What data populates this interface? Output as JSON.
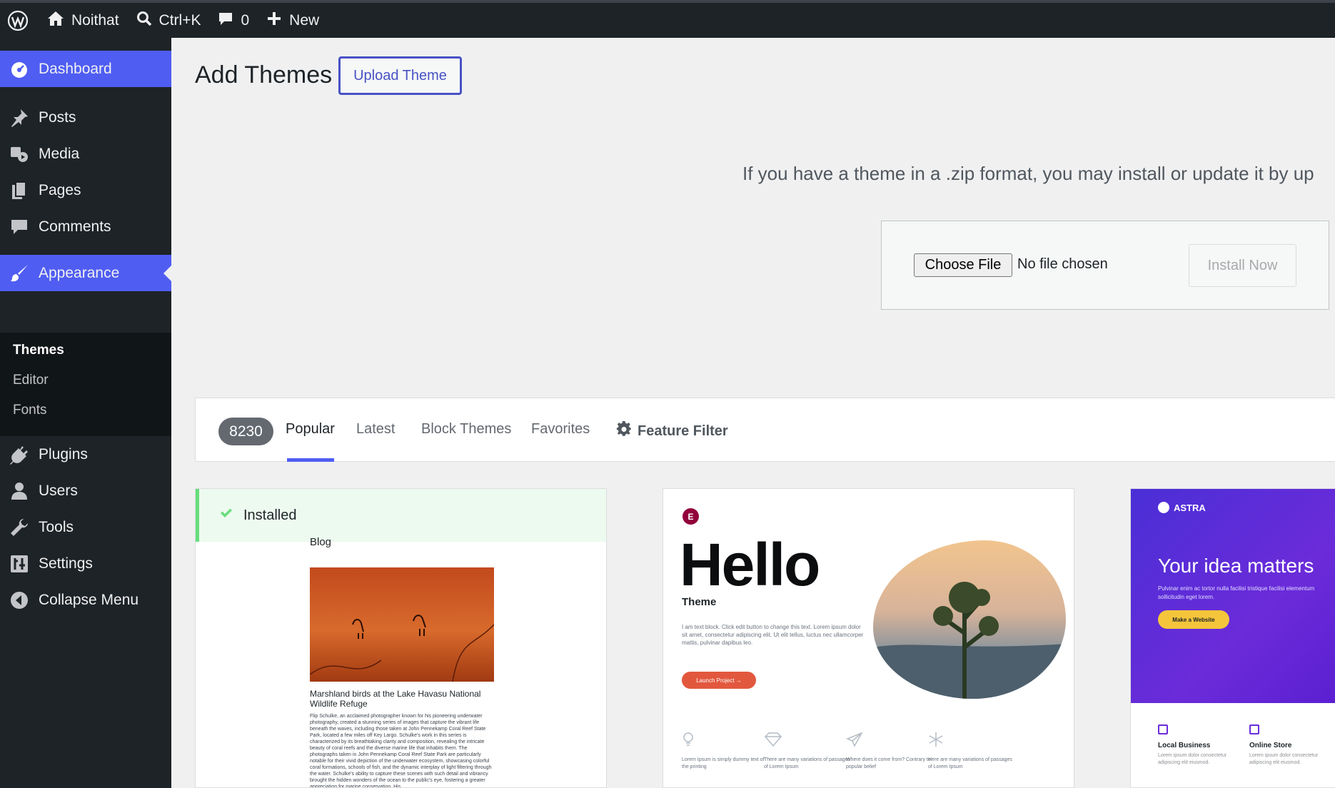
{
  "adminbar": {
    "site_name": "Noithat",
    "search_shortcut": "Ctrl+K",
    "comments_count": "0",
    "new_label": "New"
  },
  "sidebar": {
    "items": [
      {
        "label": "Dashboard",
        "icon": "dashboard-icon"
      },
      {
        "label": "Posts",
        "icon": "pin-icon"
      },
      {
        "label": "Media",
        "icon": "media-icon"
      },
      {
        "label": "Pages",
        "icon": "pages-icon"
      },
      {
        "label": "Comments",
        "icon": "comment-icon"
      },
      {
        "label": "Appearance",
        "icon": "brush-icon"
      },
      {
        "label": "Plugins",
        "icon": "plug-icon"
      },
      {
        "label": "Users",
        "icon": "user-icon"
      },
      {
        "label": "Tools",
        "icon": "wrench-icon"
      },
      {
        "label": "Settings",
        "icon": "settings-icon"
      },
      {
        "label": "Collapse Menu",
        "icon": "collapse-icon"
      }
    ],
    "submenu": [
      "Themes",
      "Editor",
      "Fonts"
    ]
  },
  "main": {
    "title": "Add Themes",
    "upload_button": "Upload Theme",
    "upload_help": "If you have a theme in a .zip format, you may install or update it by up",
    "choose_file": "Choose File",
    "no_file": "No file chosen",
    "install_now": "Install Now"
  },
  "filters": {
    "count": "8230",
    "tabs": [
      "Popular",
      "Latest",
      "Block Themes",
      "Favorites"
    ],
    "feature_filter": "Feature Filter"
  },
  "cards": {
    "installed_label": "Installed",
    "blog_word": "Blog",
    "bird_caption": "Marshland birds at the Lake Havasu National Wildlife Refuge",
    "bird_body": "Flip Schulke, an acclaimed photographer known for his pioneering underwater photography, created a stunning series of images that capture the vibrant life beneath the waves, including those taken at John Pennekamp Coral Reef State Park, located a few miles off Key Largo. Schulke's work in this series is characterized by its breathtaking clarity and composition, revealing the intricate beauty of coral reefs and the diverse marine life that inhabits them. The photographs taken in John Pennekamp Coral Reef State Park are particularly notable for their vivid depiction of the underwater ecosystem, showcasing colorful coral formations, schools of fish, and the dynamic interplay of light filtering through the water. Schulke's ability to capture these scenes with such detail and vibrancy brought the hidden wonders of the ocean to the public's eye, fostering a greater appreciation for marine conservation. His",
    "hello_logo": "E",
    "hello_title": "Hello",
    "hello_sub": "Theme",
    "hello_text": "I am text block. Click edit button to change this text. Lorem ipsum dolor sit amet, consectetur adipiscing elit. Ut elit tellus, luctus nec ullamcorper mattis, pulvinar dapibus leo.",
    "hello_cta": "Launch Project  →",
    "hello_features": [
      "Lorem Ipsum is simply dummy text of the printing",
      "There are many variations of passages of Lorem Ipsum",
      "Where does it come from? Contrary to popular belief",
      "Here are many variations of passages of Lorem Ipsum"
    ],
    "astra_logo": "ASTRA",
    "astra_title": "Your idea matters",
    "astra_text": "Pulvinar enim ac tortor nulla facilisi tristique facilisi elementum sollicitudin eget lorem.",
    "astra_cta": "Make a Website",
    "astra_features": [
      {
        "title": "Local Business",
        "text": "Lorem ipsum dolor consectetur adipiscing elit eiusmod."
      },
      {
        "title": "Online Store",
        "text": "Lorem ipsum dolor consectetur adipiscing elit eiusmod."
      }
    ]
  },
  "colors": {
    "admin_bg": "#1d2327",
    "accent": "#4f5df2",
    "installed_green": "#68de7c"
  }
}
